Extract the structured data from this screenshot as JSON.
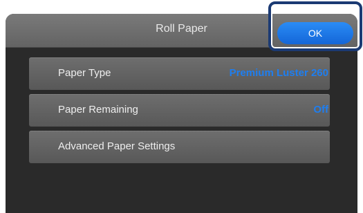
{
  "header": {
    "title": "Roll Paper",
    "ok_label": "OK"
  },
  "menu": {
    "items": [
      {
        "label": "Paper Type",
        "value": "Premium Luster 260"
      },
      {
        "label": "Paper Remaining",
        "value": "Off"
      },
      {
        "label": "Advanced Paper Settings",
        "value": ""
      }
    ]
  },
  "colors": {
    "accent": "#1e7ef0",
    "highlight_frame": "#1b3a73"
  }
}
